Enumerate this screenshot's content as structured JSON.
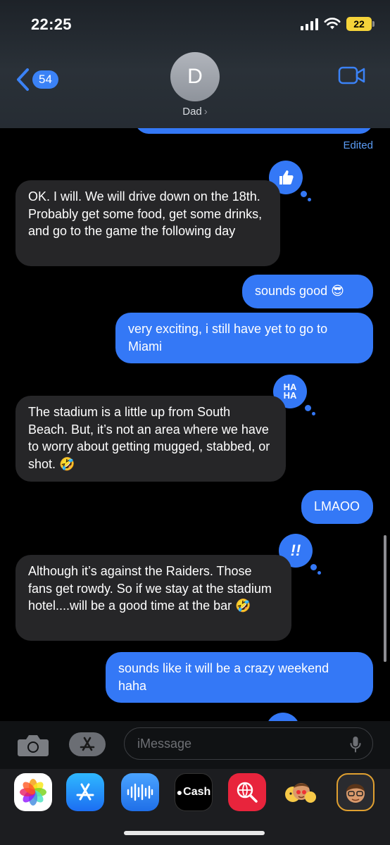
{
  "status": {
    "time": "22:25",
    "battery": "22"
  },
  "header": {
    "back_count": "54",
    "avatar_letter": "D",
    "contact_name": "Dad",
    "chevron": "›"
  },
  "messages": {
    "edited_label": "Edited",
    "items": [
      {
        "dir": "in",
        "text": "OK.  I will.  We will drive down on the 18th.  Probably get some food, get some drinks, and go to the game the following day",
        "tapback": "thumbs-up"
      },
      {
        "dir": "out",
        "text": "sounds good 😎"
      },
      {
        "dir": "out",
        "text": "very exciting, i still have yet to go to Miami"
      },
      {
        "dir": "in",
        "text": "The stadium is a little up from South Beach.  But, it’s not an area where we have to worry about getting mugged, stabbed, or shot.  🤣",
        "tapback": "haha"
      },
      {
        "dir": "out",
        "text": "LMAOO"
      },
      {
        "dir": "in",
        "text": "Although it’s against the Raiders.  Those fans get rowdy.  So if we stay at the stadium hotel....will be a good time at the bar 🤣",
        "tapback": "emphasis"
      },
      {
        "dir": "out",
        "text": "sounds like it will be a crazy weekend haha"
      }
    ],
    "tapback_haha": "HA HA",
    "tapback_emphasis": "!!"
  },
  "input": {
    "placeholder": "iMessage"
  },
  "drawer": {
    "apps": [
      "Photos",
      "App Store",
      "Audio",
      "Cash",
      "Search",
      "Memoji stickers",
      "Memoji"
    ],
    "cash_label": "Cash"
  },
  "colors": {
    "outgoing": "#3478f6",
    "incoming": "#262628",
    "background": "#000000"
  }
}
